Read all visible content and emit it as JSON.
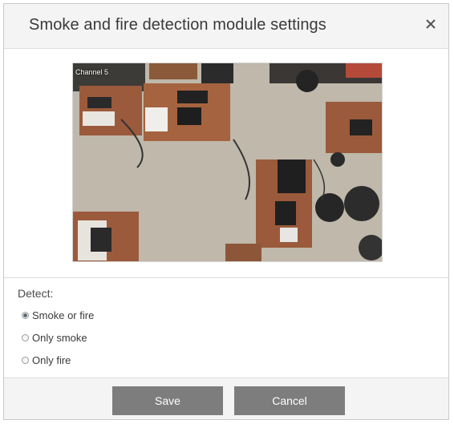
{
  "dialog": {
    "title": "Smoke and fire detection module settings",
    "close_icon": "close-icon"
  },
  "preview": {
    "channel_label": "Channel 5",
    "image": "camera-snapshot"
  },
  "detect": {
    "label": "Detect:",
    "options": [
      {
        "label": "Smoke or fire",
        "checked": true
      },
      {
        "label": "Only smoke",
        "checked": false
      },
      {
        "label": "Only fire",
        "checked": false
      }
    ]
  },
  "footer": {
    "save_label": "Save",
    "cancel_label": "Cancel"
  },
  "colors": {
    "header_bg": "#f4f4f4",
    "button_bg": "#7d7d7d"
  }
}
